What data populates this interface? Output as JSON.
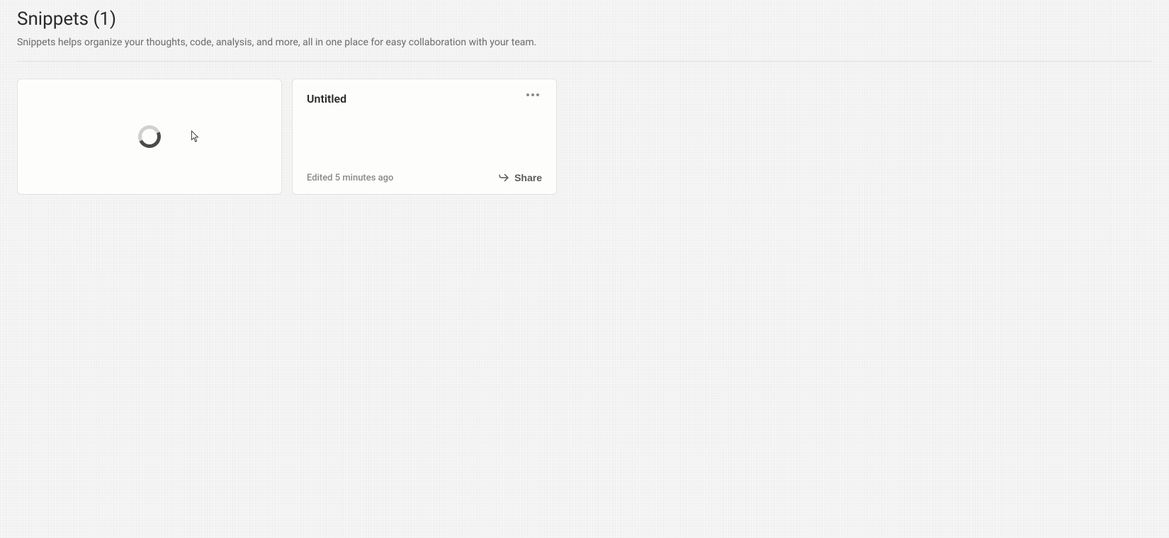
{
  "header": {
    "title": "Snippets (1)",
    "subtitle": "Snippets helps organize your thoughts, code, analysis, and more, all in one place for easy collaboration with your team."
  },
  "cards": {
    "loading": {
      "state": "loading"
    },
    "snippet": {
      "title": "Untitled",
      "edited_label": "Edited 5 minutes ago",
      "share_label": "Share"
    }
  }
}
